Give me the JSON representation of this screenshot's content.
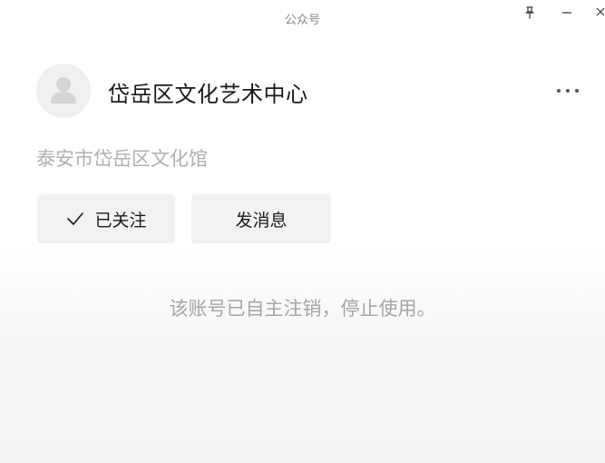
{
  "window": {
    "title": "公众号"
  },
  "account": {
    "name": "岱岳区文化艺术中心",
    "description": "泰安市岱岳区文化馆"
  },
  "actions": {
    "followed_label": "已关注",
    "message_label": "发消息"
  },
  "notice": "该账号已自主注销，停止使用。",
  "icons": {
    "pin": "pin-icon",
    "minimize": "minimize-icon",
    "close": "close-icon",
    "more": "more-icon",
    "check": "check-icon",
    "avatar": "default-avatar-icon"
  },
  "colors": {
    "button_bg": "#f2f2f2",
    "muted_text": "#b0b0b0",
    "notice_text": "#a6a6a6"
  }
}
